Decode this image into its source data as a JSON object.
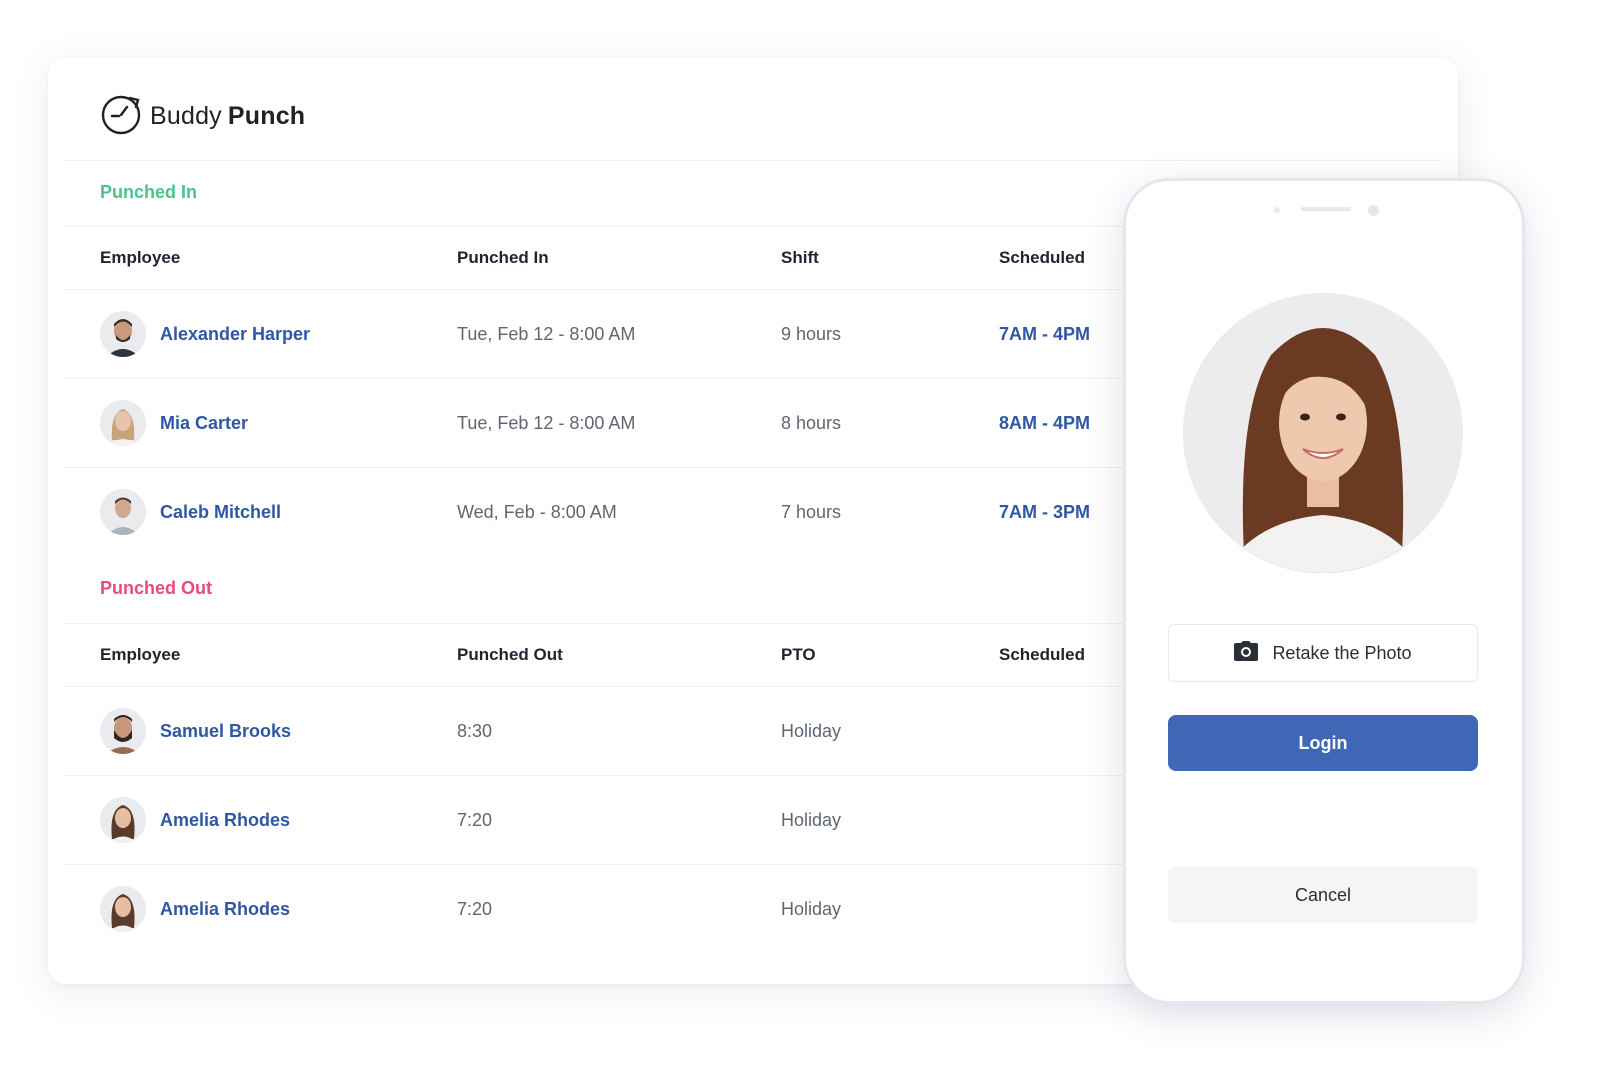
{
  "brand": {
    "name_light": "Buddy",
    "name_bold": "Punch"
  },
  "punched_in": {
    "title": "Punched In",
    "columns": [
      "Employee",
      "Punched In",
      "Shift",
      "Scheduled"
    ],
    "rows": [
      {
        "name": "Alexander Harper",
        "time": "Tue, Feb 12 - 8:00 AM",
        "shift": "9 hours",
        "scheduled": "7AM - 4PM"
      },
      {
        "name": "Mia Carter",
        "time": "Tue, Feb 12 - 8:00 AM",
        "shift": "8 hours",
        "scheduled": "8AM - 4PM"
      },
      {
        "name": "Caleb Mitchell",
        "time": "Wed, Feb - 8:00 AM",
        "shift": "7 hours",
        "scheduled": "7AM - 3PM"
      }
    ]
  },
  "punched_out": {
    "title": "Punched Out",
    "columns": [
      "Employee",
      "Punched Out",
      "PTO",
      "Scheduled"
    ],
    "rows": [
      {
        "name": "Samuel Brooks",
        "time": "8:30",
        "pto": "Holiday"
      },
      {
        "name": "Amelia Rhodes",
        "time": "7:20",
        "pto": "Holiday"
      },
      {
        "name": "Amelia Rhodes",
        "time": "7:20",
        "pto": "Holiday"
      }
    ]
  },
  "phone": {
    "retake_label": "Retake the Photo",
    "login_label": "Login",
    "cancel_label": "Cancel"
  },
  "icons": {
    "camera": "camera-icon",
    "logo": "stopwatch-icon"
  },
  "colors": {
    "punched_in": "#4cc38a",
    "punched_out": "#e84a7a",
    "link": "#2f57a3",
    "login_button": "#3f67b5"
  }
}
